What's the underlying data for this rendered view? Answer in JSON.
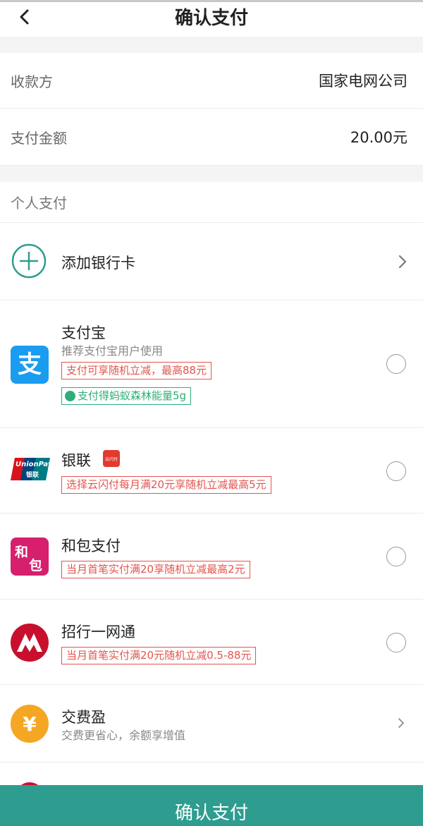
{
  "header": {
    "title": "确认支付"
  },
  "order": {
    "payee_label": "收款方",
    "payee_value": "国家电网公司",
    "amount_label": "支付金额",
    "amount_value": "20.00元"
  },
  "personal": {
    "section_label": "个人支付",
    "add_card_label": "添加银行卡"
  },
  "methods": {
    "alipay": {
      "name": "支付宝",
      "subtitle": "推荐支付宝用户使用",
      "promo": "支付可享随机立减，最高88元",
      "energy": "支付得蚂蚁森林能量5g",
      "logo_text": "支"
    },
    "unionpay": {
      "name": "银联",
      "promo": "选择云闪付每月满20元享随机立减最高5元",
      "logo_text_a": "UnionPay",
      "logo_text_b": "银联",
      "badge_text": "云闪付"
    },
    "hebao": {
      "name": "和包支付",
      "promo": "当月首笔实付满20享随机立减最高2元",
      "logo_text_a": "和",
      "logo_text_b": "包"
    },
    "cmb": {
      "name": "招行一网通",
      "promo": "当月首笔实付满20元随机立减0.5-88元"
    },
    "jiaofeiying": {
      "name": "交费盈",
      "subtitle": "交费更省心，余额享增值",
      "logo_text": "¥"
    }
  },
  "footer": {
    "confirm_label": "确认支付"
  },
  "colors": {
    "accent": "#2f9c90",
    "promo_red": "#e2554f",
    "energy_green": "#2fae7a",
    "alipay_blue": "#1a9cf0",
    "hebao_pink": "#d61f6d",
    "cmb_red": "#c8102e",
    "jiaofeiying_gold": "#f5a623"
  }
}
